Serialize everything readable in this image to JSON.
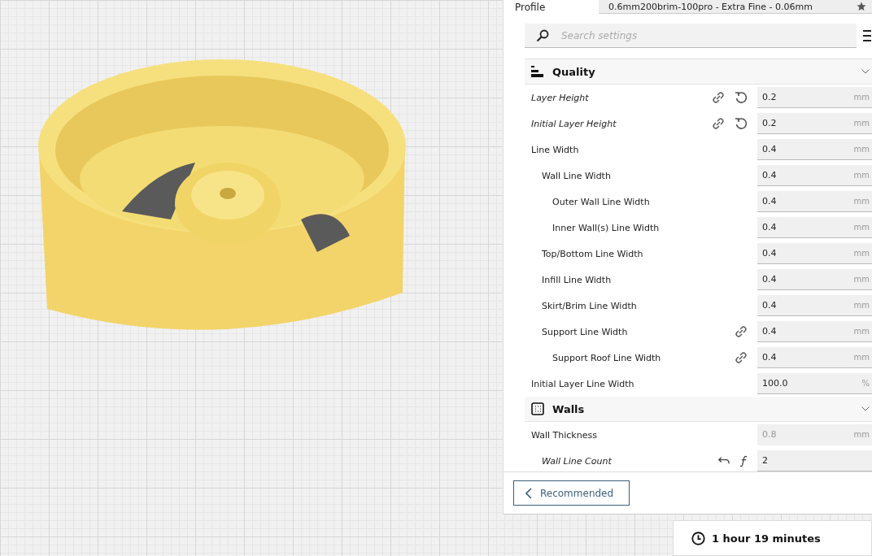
{
  "profile": {
    "label": "Profile",
    "name": "0.6mm200brim-100pro",
    "quality": " - Extra Fine - 0.06mm"
  },
  "search": {
    "placeholder": "Search settings"
  },
  "sections": [
    {
      "title": "Quality",
      "kind": "quality",
      "expanded": true,
      "settings": [
        {
          "label": "Layer Height",
          "value": "0.2",
          "unit": "mm",
          "modified": true,
          "linked": true,
          "resettable": true,
          "disabled": false
        },
        {
          "label": "Initial Layer Height",
          "value": "0.2",
          "unit": "mm",
          "modified": true,
          "linked": true,
          "resettable": true,
          "disabled": false
        },
        {
          "label": "Line Width",
          "value": "0.4",
          "unit": "mm",
          "modified": false,
          "disabled": false,
          "children": [
            {
              "label": "Wall Line Width",
              "value": "0.4",
              "unit": "mm",
              "modified": false,
              "disabled": false,
              "children": [
                {
                  "label": "Outer Wall Line Width",
                  "value": "0.4",
                  "unit": "mm",
                  "modified": false,
                  "disabled": false
                },
                {
                  "label": "Inner Wall(s) Line Width",
                  "value": "0.4",
                  "unit": "mm",
                  "modified": false,
                  "disabled": false
                }
              ]
            },
            {
              "label": "Top/Bottom Line Width",
              "value": "0.4",
              "unit": "mm",
              "modified": false,
              "disabled": false
            },
            {
              "label": "Infill Line Width",
              "value": "0.4",
              "unit": "mm",
              "modified": false,
              "disabled": false
            },
            {
              "label": "Skirt/Brim Line Width",
              "value": "0.4",
              "unit": "mm",
              "modified": false,
              "disabled": false
            },
            {
              "label": "Support Line Width",
              "value": "0.4",
              "unit": "mm",
              "modified": false,
              "linked": true,
              "disabled": false,
              "children": [
                {
                  "label": "Support Roof Line Width",
                  "value": "0.4",
                  "unit": "mm",
                  "modified": false,
                  "linked": true,
                  "disabled": false
                }
              ]
            }
          ]
        },
        {
          "label": "Initial Layer Line Width",
          "value": "100.0",
          "unit": "%",
          "modified": false,
          "disabled": false
        }
      ]
    },
    {
      "title": "Walls",
      "kind": "walls",
      "expanded": true,
      "settings": [
        {
          "label": "Wall Thickness",
          "value": "0.8",
          "unit": "mm",
          "modified": false,
          "disabled": true,
          "children": [
            {
              "label": "Wall Line Count",
              "value": "2",
              "modified": true,
              "resettable": true,
              "function": true,
              "disabled": false
            }
          ]
        }
      ]
    }
  ],
  "mode_button": {
    "label": "Recommended"
  },
  "print_time": {
    "text": "1 hour 19 minutes"
  }
}
